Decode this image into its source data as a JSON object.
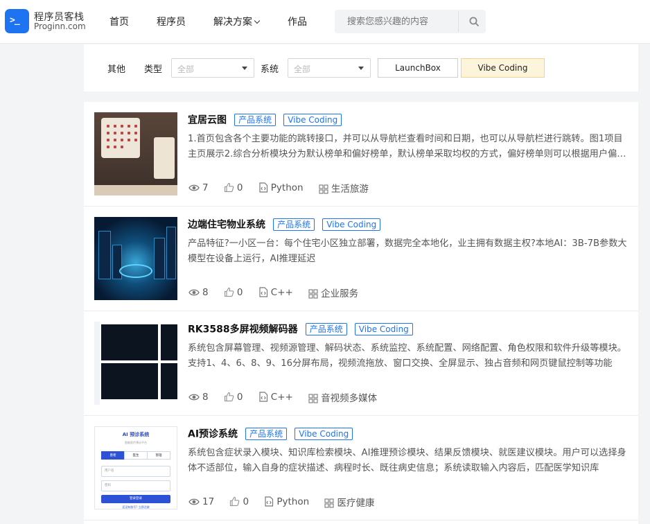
{
  "brand": {
    "name_cn": "程序员客栈",
    "name_en": "Proginn.com",
    "logo_glyph": ">_",
    "accent": "#1e73f0"
  },
  "nav": {
    "home": "首页",
    "programmers": "程序员",
    "solutions": "解决方案",
    "works": "作品"
  },
  "search": {
    "placeholder": "搜索您感兴趣的内容",
    "icon": "search-icon"
  },
  "filter": {
    "group_label": "其他",
    "type_label": "类型",
    "type_value": "全部",
    "system_label": "系统",
    "system_value": "全部",
    "buttons": [
      "LaunchBox",
      "Vibe Coding"
    ],
    "active_button": "Vibe Coding",
    "active_color": "#fdf4dc"
  },
  "items": [
    {
      "title": "宜居云图",
      "tags": [
        "产品系统",
        "Vibe Coding"
      ],
      "desc": "1.首页包含各个主要功能的跳转接口，并可以从导航栏查看时间和日期，也可以从导航栏进行跳转。图1项目主页展示2.综合分析模块分为默认榜单和偏好榜单，默认榜单采取均权的方式，偏好榜单则可以根据用户偏好进行设置",
      "views": "7",
      "likes": "0",
      "language": "Python",
      "category": "生活旅游"
    },
    {
      "title": "边端住宅物业系统",
      "tags": [
        "产品系统",
        "Vibe Coding"
      ],
      "desc": "产品特征?一小区一台：每个住宅小区独立部署，数据完全本地化，业主拥有数据主权?本地AI：3B-7B参数大模型在设备上运行，AI推理延迟",
      "views": "8",
      "likes": "0",
      "language": "C++",
      "category": "企业服务"
    },
    {
      "title": "RK3588多屏视频解码器",
      "tags": [
        "产品系统",
        "Vibe Coding"
      ],
      "desc": "系统包含屏幕管理、视频源管理、解码状态、系统监控、系统配置、网络配置、角色权限和软件升级等模块。支持1、4、6、8、9、16分屏布局，视频流拖放、窗口交换、全屏显示、独占音频和网页键鼠控制等功能",
      "views": "8",
      "likes": "0",
      "language": "C++",
      "category": "音视频多媒体"
    },
    {
      "title": "AI预诊系统",
      "tags": [
        "产品系统",
        "Vibe Coding"
      ],
      "desc": "系统包含症状录入模块、知识库检索模块、AI推理预诊模块、结果反馈模块、就医建议模块。用户可以选择身体不适部位，输入自身的症状描述、病程时长、既往病史信息；系统读取输入内容后，匹配医学知识库",
      "views": "17",
      "likes": "0",
      "language": "Python",
      "category": "医疗健康"
    }
  ],
  "thumb4": {
    "title": "AI 预诊系统",
    "subtitle": "智能医疗预诊平台",
    "segments": [
      "患者",
      "医生",
      "管理"
    ],
    "fields": [
      "用户名",
      "密码"
    ],
    "button": "登录登录",
    "footer": "还没有账号? 立即注册"
  }
}
